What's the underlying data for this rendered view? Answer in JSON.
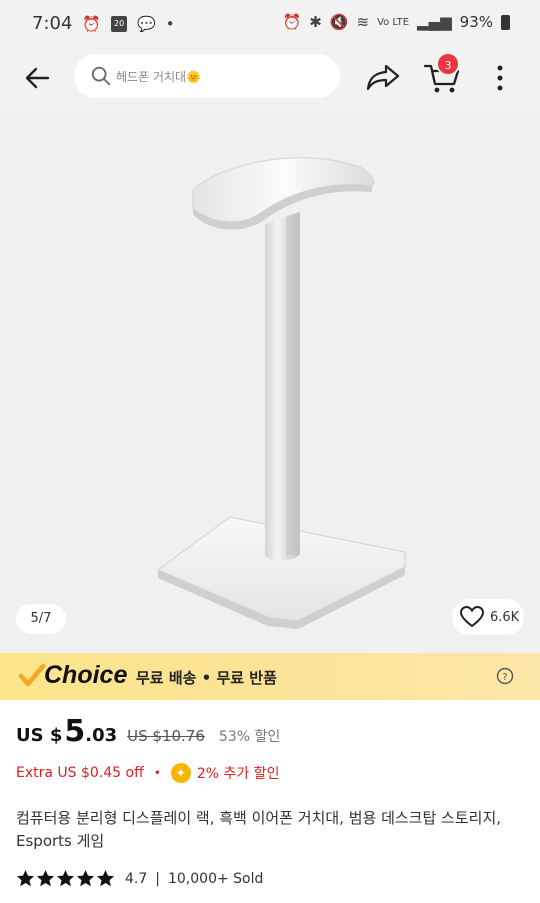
{
  "status_bar": {
    "time": "7:04",
    "calendar_day": "20",
    "signal_text": "Vo LTE",
    "battery": "93%"
  },
  "topbar": {
    "search_placeholder": "헤드폰 거치대🌞",
    "cart_count": "3"
  },
  "gallery": {
    "image_index": "5/7",
    "likes": "6.6K"
  },
  "choice": {
    "logo": "Choice",
    "benefits": "무료 배송 • 무료 반품"
  },
  "price": {
    "currency": "US $",
    "integer": "5",
    "decimal": ".03",
    "original": "US $10.76",
    "discount": "53% 할인"
  },
  "extra": {
    "extra_off": "Extra US $0.45 off",
    "bonus": "2% 추가 할인"
  },
  "product": {
    "title": "컴퓨터용 분리형 디스플레이 랙, 흑백 이어폰 거치대, 범용 데스크탑 스토리지, Esports 게임"
  },
  "rating": {
    "score": "4.7",
    "stars": 5,
    "sold": "10,000+ Sold"
  },
  "colors": {
    "accent": "#e8383d",
    "choice_bg": "#fde58b",
    "choice_check": "#f5a623"
  }
}
